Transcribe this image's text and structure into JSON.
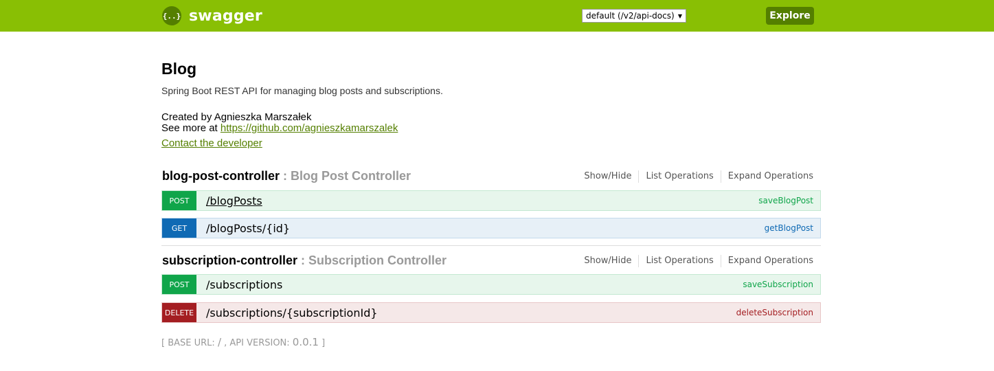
{
  "header": {
    "logo_icon": "{..}",
    "logo_text": "swagger",
    "spec_select_value": "default (/v2/api-docs)",
    "explore_label": "Explore"
  },
  "info": {
    "title": "Blog",
    "description": "Spring Boot REST API for managing blog posts and subscriptions.",
    "created_by": "Created by Agnieszka Marszałek",
    "see_more_prefix": "See more at ",
    "see_more_link": "https://github.com/agnieszkamarszalek",
    "contact_label": "Contact the developer"
  },
  "resources": [
    {
      "name": "blog-post-controller",
      "separator": " : ",
      "description": "Blog Post Controller",
      "options": [
        "Show/Hide",
        "List Operations",
        "Expand Operations"
      ],
      "operations": [
        {
          "method": "POST",
          "path": "/blogPosts",
          "nickname": "saveBlogPost"
        },
        {
          "method": "GET",
          "path": "/blogPosts/{id}",
          "nickname": "getBlogPost"
        }
      ]
    },
    {
      "name": "subscription-controller",
      "separator": " : ",
      "description": "Subscription Controller",
      "options": [
        "Show/Hide",
        "List Operations",
        "Expand Operations"
      ],
      "operations": [
        {
          "method": "POST",
          "path": "/subscriptions",
          "nickname": "saveSubscription"
        },
        {
          "method": "DELETE",
          "path": "/subscriptions/{subscriptionId}",
          "nickname": "deleteSubscription"
        }
      ]
    }
  ],
  "footer": {
    "open_bracket": "[ ",
    "base_url_label": "BASE URL: ",
    "base_url_value": "/",
    "api_version_label": " , API VERSION: ",
    "api_version_value": "0.0.1",
    "close_bracket": " ]"
  },
  "colors": {
    "header_bg": "#89bf04",
    "post": "#10a54a",
    "get": "#0f6ab4",
    "delete": "#a41e22"
  }
}
